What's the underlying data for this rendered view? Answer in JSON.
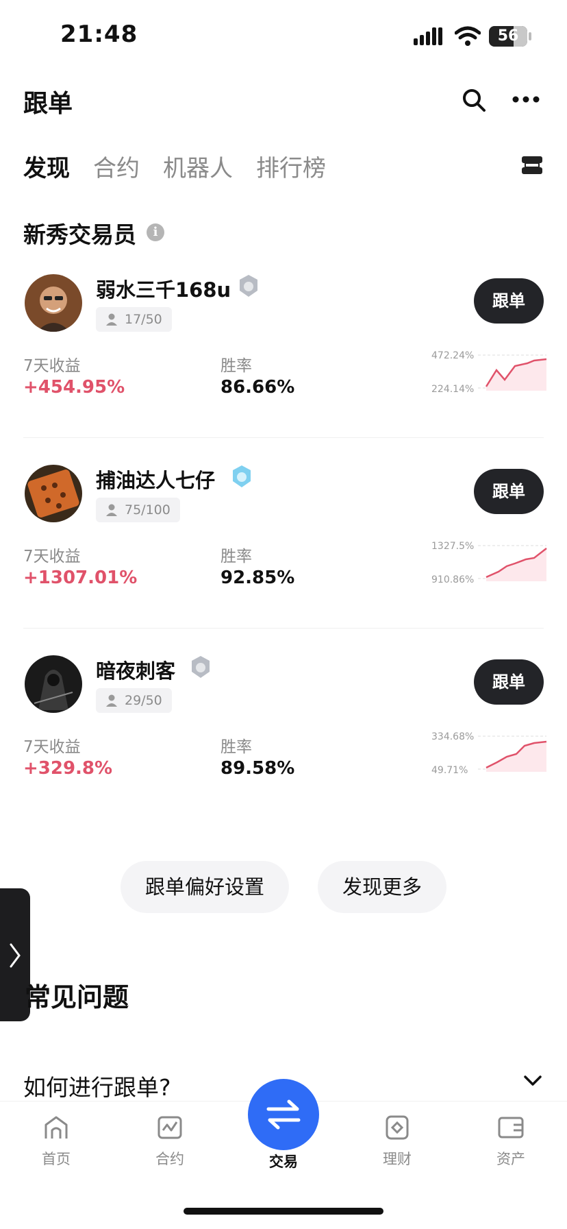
{
  "status_bar": {
    "time": "21:48",
    "battery": "56"
  },
  "header": {
    "title": "跟单"
  },
  "tabs": [
    {
      "label": "发现",
      "active": true
    },
    {
      "label": "合约",
      "active": false
    },
    {
      "label": "机器人",
      "active": false
    },
    {
      "label": "排行榜",
      "active": false
    }
  ],
  "section": {
    "title": "新秀交易员"
  },
  "labels": {
    "profit_7d": "7天收益",
    "win_rate": "胜率",
    "follow": "跟单"
  },
  "traders": [
    {
      "name": "弱水三千168u",
      "badge": "silver-medal",
      "followers": "17/50",
      "profit": "+454.95%",
      "win_rate": "86.66%",
      "chart_high": "472.24%",
      "chart_low": "224.14%"
    },
    {
      "name": "捕油达人七仔",
      "badge": "blue-medal",
      "followers": "75/100",
      "profit": "+1307.01%",
      "win_rate": "92.85%",
      "chart_high": "1327.5%",
      "chart_low": "910.86%"
    },
    {
      "name": "暗夜刺客",
      "badge": "silver-medal",
      "followers": "29/50",
      "profit": "+329.8%",
      "win_rate": "89.58%",
      "chart_high": "334.68%",
      "chart_low": "49.71%"
    }
  ],
  "actions": {
    "preferences": "跟单偏好设置",
    "discover_more": "发现更多"
  },
  "faq": {
    "title": "常见问题",
    "question": "如何进行跟单?"
  },
  "bottom_nav": [
    {
      "label": "首页",
      "icon": "home-icon"
    },
    {
      "label": "合约",
      "icon": "contract-chart-icon"
    },
    {
      "label": "交易",
      "icon": "swap-arrows-icon",
      "active": true
    },
    {
      "label": "理财",
      "icon": "finance-icon"
    },
    {
      "label": "资产",
      "icon": "wallet-icon"
    }
  ],
  "colors": {
    "profit": "#e0526a",
    "accent": "#2f6cf6",
    "dark_button": "#232428"
  }
}
